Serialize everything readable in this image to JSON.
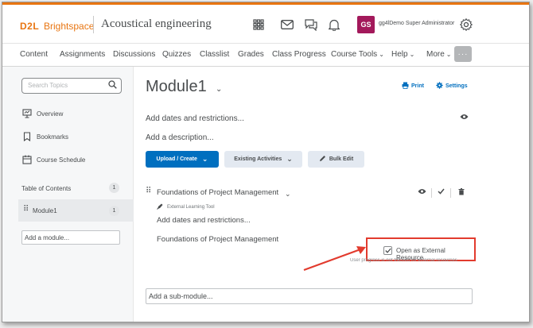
{
  "header": {
    "logo_d2l": "D2L",
    "logo_brand": "Brightspace",
    "course_title": "Acoustical engineering",
    "avatar_initials": "GS",
    "username": "gg4lDemo Super Administrator",
    "accent_color": "#e87511"
  },
  "nav": {
    "items": [
      "Content",
      "Assignments",
      "Discussions",
      "Quizzes",
      "Classlist",
      "Grades",
      "Class Progress",
      "Course Tools",
      "Help",
      "More"
    ],
    "more_dots": "···"
  },
  "sidebar": {
    "search_placeholder": "Search Topics",
    "overview": "Overview",
    "bookmarks": "Bookmarks",
    "course_schedule": "Course Schedule",
    "toc_label": "Table of Contents",
    "toc_count": "1",
    "module_label": "Module1",
    "module_count": "1",
    "add_module": "Add a module..."
  },
  "main": {
    "title": "Module1",
    "print": "Print",
    "settings": "Settings",
    "add_dates": "Add dates and restrictions...",
    "add_description": "Add a description...",
    "upload_create": "Upload / Create",
    "existing_activities": "Existing Activities",
    "bulk_edit": "Bulk Edit",
    "topic_title": "Foundations of Project Management",
    "topic_type": "External Learning Tool",
    "topic_add_dates": "Add dates and restrictions...",
    "topic_body": "Foundations of Project Management",
    "open_external": "Open as External Resource",
    "hint": "User progress is not tracked for external resources",
    "add_submodule": "Add a sub-module...",
    "highlight_color": "#e23b2e"
  }
}
